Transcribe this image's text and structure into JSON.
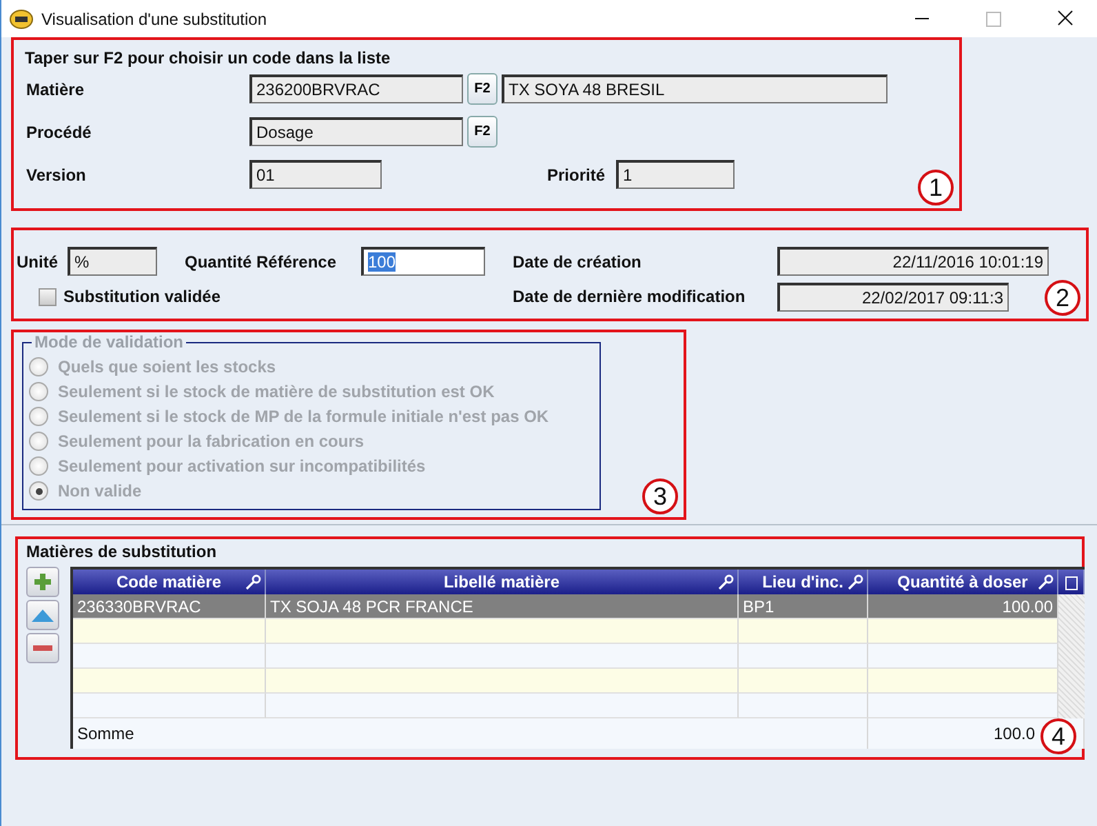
{
  "window": {
    "title": "Visualisation d'une substitution"
  },
  "identification": {
    "legend": "Taper sur F2 pour choisir un code dans la liste",
    "badge": "1",
    "matiere": {
      "label": "Matière",
      "code": "236200BRVRAC",
      "button": "F2",
      "name": "TX SOYA 48 BRESIL"
    },
    "procede": {
      "label": "Procédé",
      "value": "Dosage",
      "button": "F2"
    },
    "version": {
      "label": "Version",
      "value": "01"
    },
    "priorite": {
      "label": "Priorité",
      "value": "1"
    }
  },
  "quantities": {
    "badge": "2",
    "unite": {
      "label": "Unité",
      "value": "%"
    },
    "quantite": {
      "label": "Quantité Référence",
      "value": "100"
    },
    "validated": {
      "label": "Substitution validée",
      "checked": false
    },
    "creation": {
      "label": "Date de création",
      "value": "22/11/2016 10:01:19"
    },
    "modification": {
      "label": "Date de dernière modification",
      "value": "22/02/2017 09:11:3"
    }
  },
  "validation_mode": {
    "legend": "Mode de validation",
    "disabled": true,
    "badge": "3",
    "options": [
      {
        "label": "Quels que soient les stocks",
        "selected": false
      },
      {
        "label": "Seulement si le stock de matière de substitution est OK",
        "selected": false
      },
      {
        "label": "Seulement si le stock de MP de la formule initiale n'est pas OK",
        "selected": false
      },
      {
        "label": "Seulement pour la fabrication en cours",
        "selected": false
      },
      {
        "label": "Seulement pour activation sur incompatibilités",
        "selected": false
      },
      {
        "label": "Non valide",
        "selected": true
      }
    ]
  },
  "substitutes": {
    "legend": "Matières de substitution",
    "badge": "4",
    "columns": [
      "Code matière",
      "Libellé matière",
      "Lieu d'inc.",
      "Quantité à doser"
    ],
    "rows": [
      {
        "cells": [
          "236330BRVRAC",
          "TX SOJA 48 PCR FRANCE",
          "BP1",
          "100.00"
        ],
        "selected": true
      }
    ],
    "sum": {
      "label": "Somme",
      "value": "100.0"
    }
  }
}
